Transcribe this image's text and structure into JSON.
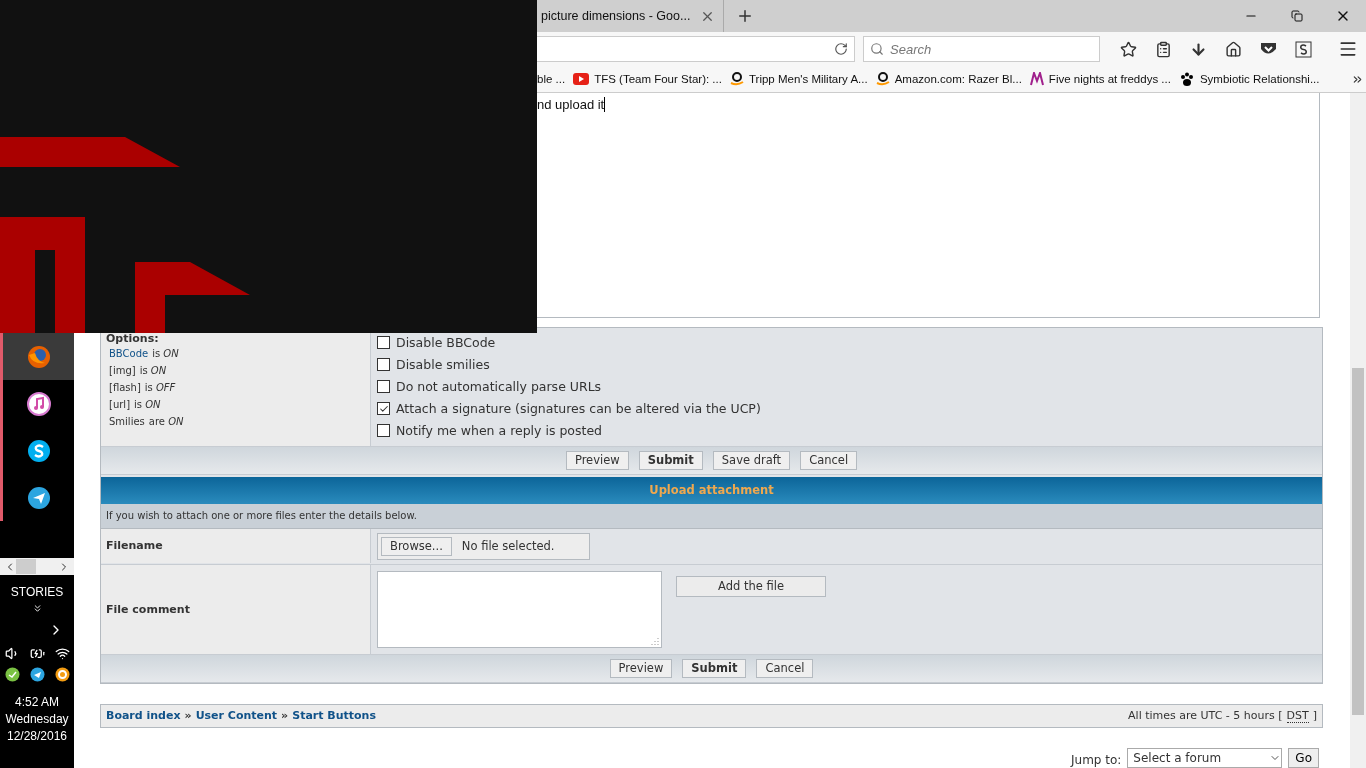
{
  "browser": {
    "tab": {
      "title": "picture dimensions - Goo..."
    },
    "search": {
      "placeholder": "Search"
    },
    "bookmarks": [
      {
        "kind": "none",
        "label": "ble ..."
      },
      {
        "kind": "video",
        "label": "TFS (Team Four Star): ..."
      },
      {
        "kind": "shop",
        "label": "Tripp Men's Military A..."
      },
      {
        "kind": "shop",
        "label": "Amazon.com: Razer Bl..."
      },
      {
        "kind": "letter",
        "label": "Five nights at freddys ..."
      },
      {
        "kind": "paw",
        "label": "Symbiotic Relationshi..."
      }
    ]
  },
  "editor": {
    "text": "nd upload it"
  },
  "options": {
    "title": "Options:",
    "status": [
      {
        "name": "BBCode",
        "link": true,
        "text": "is *ON*"
      },
      {
        "name": "[img]",
        "link": false,
        "text": "is *ON*"
      },
      {
        "name": "[flash]",
        "link": false,
        "text": "is *OFF*"
      },
      {
        "name": "[url]",
        "link": false,
        "text": "is *ON*"
      },
      {
        "name": "Smilies",
        "link": false,
        "text": "are *ON*"
      }
    ],
    "checkboxes": [
      {
        "label": "Disable BBCode",
        "checked": false
      },
      {
        "label": "Disable smilies",
        "checked": false
      },
      {
        "label": "Do not automatically parse URLs",
        "checked": false
      },
      {
        "label": "Attach a signature (signatures can be altered via the UCP)",
        "checked": true
      },
      {
        "label": "Notify me when a reply is posted",
        "checked": false
      }
    ]
  },
  "post_buttons": [
    {
      "label": "Preview",
      "primary": false
    },
    {
      "label": "Submit",
      "primary": true
    },
    {
      "label": "Save draft",
      "primary": false
    },
    {
      "label": "Cancel",
      "primary": false
    }
  ],
  "upload": {
    "title": "Upload attachment",
    "info": "If you wish to attach one or more files enter the details below.",
    "filename_label": "Filename",
    "browse": "Browse...",
    "file_status": "No file selected.",
    "comment_label": "File comment",
    "add_button": "Add the file",
    "buttons": [
      {
        "label": "Preview",
        "primary": false
      },
      {
        "label": "Submit",
        "primary": true
      },
      {
        "label": "Cancel",
        "primary": false
      }
    ]
  },
  "footer": {
    "breadcrumbs": [
      {
        "label": "Board index",
        "separator": "»"
      },
      {
        "label": "User Content",
        "separator": "»"
      },
      {
        "label": "Start Buttons"
      }
    ],
    "timezone": "All times are UTC - 5 hours [",
    "dst": "DST",
    "close": "]"
  },
  "jump": {
    "label": "Jump to:",
    "select": "Select a forum",
    "go": "Go"
  },
  "sidebar": {
    "apps": [
      {
        "kind": "firefox",
        "selected": true
      },
      {
        "kind": "music",
        "selected": false
      },
      {
        "kind": "skype",
        "selected": false
      },
      {
        "kind": "telegram",
        "selected": false
      }
    ],
    "section": "STORIES",
    "time": "4:52 AM",
    "day": "Wednesday",
    "date": "12/28/2016"
  }
}
